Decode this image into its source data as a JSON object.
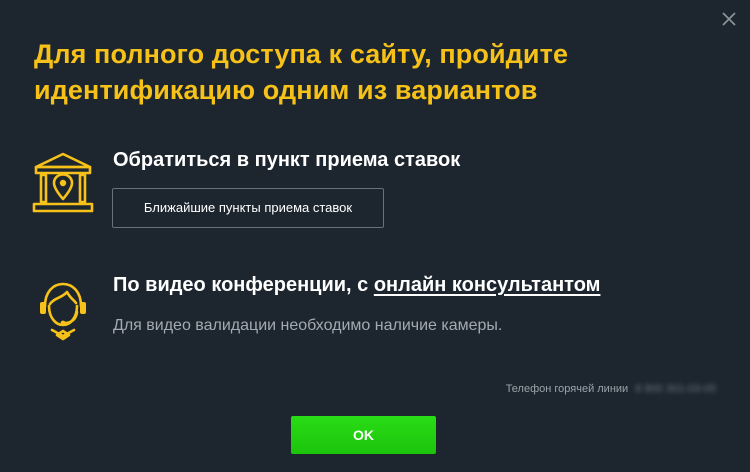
{
  "modal": {
    "title": "Для полного доступа к сайту, пройдите идентификацию одним из вариантов",
    "close_icon": "close-icon"
  },
  "options": [
    {
      "icon": "bank-location-icon",
      "heading": "Обратиться в пункт приема ставок",
      "button_label": "Ближайшие пункты приема ставок"
    },
    {
      "icon": "operator-headset-icon",
      "heading_prefix": "По видео конференции, с ",
      "heading_link": "онлайн консультантом",
      "note": "Для видео валидации необходимо наличие камеры."
    }
  ],
  "hotline": {
    "label": "Телефон горячей линии",
    "number": "8 800 301-03-05"
  },
  "ok_label": "OK",
  "colors": {
    "background": "#1d262f",
    "accent_yellow": "#f6c118",
    "ok_green": "#22d012"
  }
}
